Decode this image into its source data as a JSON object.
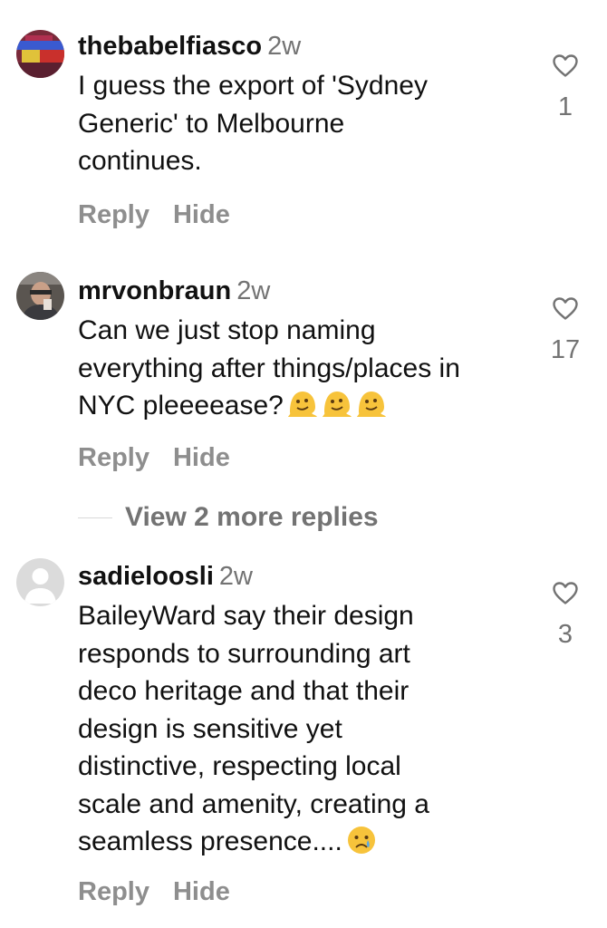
{
  "comments": [
    {
      "username": "thebabelfiasco",
      "time": "2w",
      "lines": [
        "I guess the export of 'Sydney",
        "Generic' to Melbourne",
        "continues."
      ],
      "reply_label": "Reply",
      "hide_label": "Hide",
      "likes": "1",
      "avatar_icon": "profile-photo-abstract",
      "like_icon": "heart-outline-icon"
    },
    {
      "username": "mrvonbraun",
      "time": "2w",
      "lines": [
        "Can we just stop naming",
        "everything after things/places in",
        "NYC pleeeease?"
      ],
      "emojis": [
        "melting-face",
        "melting-face",
        "melting-face"
      ],
      "reply_label": "Reply",
      "hide_label": "Hide",
      "likes": "17",
      "avatar_icon": "profile-photo-person",
      "like_icon": "heart-outline-icon"
    },
    {
      "username": "sadieloosli",
      "time": "2w",
      "lines": [
        "BaileyWard say their design",
        "responds to surrounding art",
        "deco heritage and that their",
        "design is sensitive yet",
        "distinctive, respecting local",
        "scale and amenity, creating a",
        "seamless presence...."
      ],
      "emojis": [
        "crying-face"
      ],
      "reply_label": "Reply",
      "hide_label": "Hide",
      "likes": "3",
      "avatar_icon": "default-avatar-icon",
      "like_icon": "heart-outline-icon"
    }
  ],
  "view_more_replies": "View 2 more replies",
  "colors": {
    "text": "#111111",
    "secondary": "#737373",
    "action": "#8e8e8e",
    "default_avatar_bg": "#dbdbdb",
    "default_avatar_fg": "#ffffff",
    "emoji": "#f7c33b"
  }
}
